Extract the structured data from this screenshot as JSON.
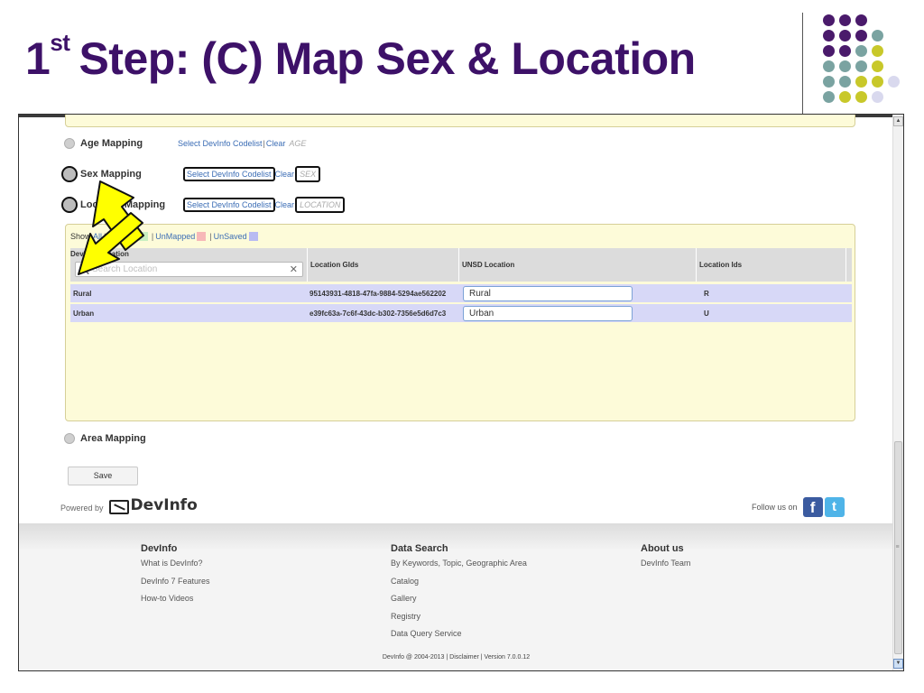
{
  "slide": {
    "title_number": "1",
    "title_sup": "st",
    "title_rest": "Step: (C) Map Sex & Location",
    "dot_colors": [
      "#4a1a6b",
      "#7aa3a1",
      "#c8c82a",
      "#d9d9ee"
    ]
  },
  "mappings": {
    "age": {
      "label": "Age Mapping",
      "select": "Select DevInfo Codelist",
      "clear": "Clear",
      "code": "AGE"
    },
    "sex": {
      "label": "Sex Mapping",
      "select": "Select DevInfo Codelist",
      "clear": "Clear",
      "code": "SEX"
    },
    "location": {
      "label": "Location Mapping",
      "select": "Select DevInfo Codelist",
      "clear": "Clear",
      "code": "LOCATION"
    },
    "area": {
      "label": "Area Mapping"
    }
  },
  "legend": {
    "show": "Show",
    "all": "All",
    "mapped": "Mapped",
    "unmapped": "UnMapped",
    "unsaved": "UnSaved",
    "colors": {
      "mapped": "#c8efc0",
      "unmapped": "#f7b8b8",
      "unsaved": "#b9bbf2"
    }
  },
  "table": {
    "columns": [
      "DevInfo Location",
      "Location GIds",
      "UNSD Location",
      "Location Ids"
    ],
    "search_placeholder": "Search Location",
    "rows": [
      {
        "name": "Rural",
        "gid": "95143931-4818-47fa-9884-5294ae562202",
        "unsd": "Rural",
        "id": "R"
      },
      {
        "name": "Urban",
        "gid": "e39fc63a-7c6f-43dc-b302-7356e5d6d7c3",
        "unsd": "Urban",
        "id": "U"
      }
    ]
  },
  "actions": {
    "save": "Save"
  },
  "branding": {
    "powered_by": "Powered by",
    "logo": "DevInfo",
    "follow": "Follow us on",
    "facebook": "f",
    "twitter": "t"
  },
  "footer": {
    "columns": [
      {
        "title": "DevInfo",
        "links": [
          "What is DevInfo?",
          "DevInfo 7 Features",
          "How-to Videos"
        ]
      },
      {
        "title": "Data Search",
        "links": [
          "By Keywords, Topic, Geographic Area",
          "Catalog",
          "Gallery",
          "Registry",
          "Data Query Service"
        ]
      },
      {
        "title": "About us",
        "links": [
          "DevInfo Team"
        ]
      }
    ],
    "copyright": "DevInfo @ 2004-2013 | Disclaimer | Version 7.0.0.12"
  },
  "scrollbar": {
    "up": "▲",
    "down": "▼",
    "grip": "≡"
  }
}
